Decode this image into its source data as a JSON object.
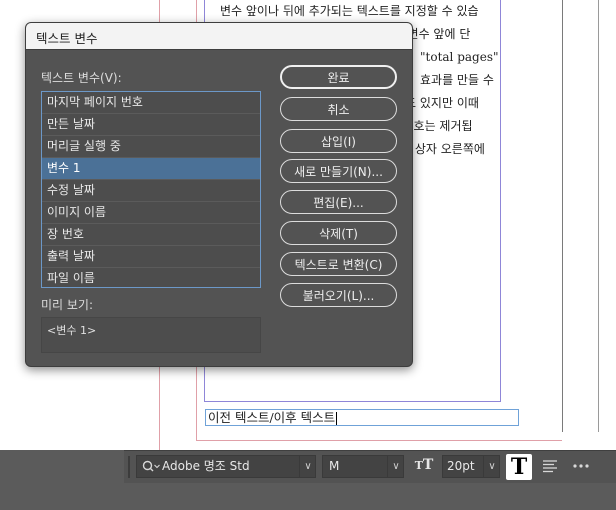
{
  "document": {
    "lines": [
      "변수 앞이나 뒤에 추가되는 텍스트를 지정할 수 있습",
      "조] 변수 앞에 단",
      "\"total pages\"",
      "효과를 만들 수",
      "수도 있지만 이때",
      "] 번호는 제거됩",
      "트 상자 오른쪽에"
    ],
    "text_frame": "이전 텍스트/이후 텍스트"
  },
  "dialog": {
    "title": "텍스트 변수",
    "list_label": "텍스트 변수(V):",
    "variables": [
      "마지막 페이지 번호",
      "만든 날짜",
      "머리글 실행 중",
      "변수 1",
      "수정 날짜",
      "이미지 이름",
      "장 번호",
      "출력 날짜",
      "파일 이름"
    ],
    "selected_index": 3,
    "preview_label": "미리 보기:",
    "preview_text": "<변수 1>",
    "buttons": {
      "done": "완료",
      "cancel": "취소",
      "insert": "삽입(I)",
      "new": "새로 만들기(N)...",
      "edit": "편집(E)...",
      "delete": "삭제(T)",
      "convert": "텍스트로 변환(C)",
      "load": "불러오기(L)..."
    }
  },
  "control_bar": {
    "font_family": "Adobe 명조 Std",
    "font_style": "M",
    "font_size": "20pt",
    "icons": [
      "search-icon",
      "font-size-icon",
      "type-icon",
      "align-icon",
      "more-icon"
    ]
  },
  "colors": {
    "dialog_bg": "#535353",
    "selection": "#4b7197",
    "frame_blue": "#6fa2d8"
  }
}
